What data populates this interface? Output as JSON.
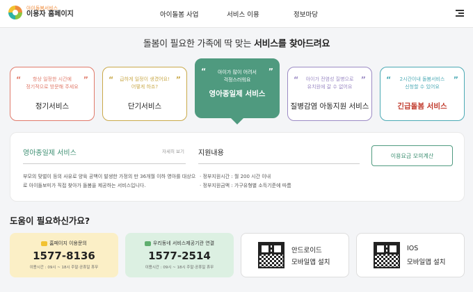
{
  "header": {
    "logo_sub": "아이돌봄서비스",
    "logo_main": "이용자 홈페이지",
    "nav": [
      "아이돌봄 사업",
      "서비스 이용",
      "정보마당"
    ],
    "menu_icon": "hamburger-menu-icon"
  },
  "headline": {
    "prefix": "돌봄이 필요한 가족에 딱 맞는 ",
    "emphasis": "서비스를 찾아드려요"
  },
  "service_cards": [
    {
      "quote_1": "항상 일정한 시간에",
      "quote_2": "정기적으로 방문해 주세요",
      "name": "정기서비스",
      "color": "#e07a6a",
      "active": false
    },
    {
      "quote_1": "급하게 일정이 생겼어요!",
      "quote_2": "어떻게 하죠?",
      "name": "단기서비스",
      "color": "#c9a94a",
      "active": false
    },
    {
      "quote_1": "아이가 많이 어려서",
      "quote_2": "걱정스러워요",
      "name": "영아종일제 서비스",
      "color": "#4f9a7f",
      "active": true
    },
    {
      "quote_1": "아이가 전염성 질병으로",
      "quote_2": "유치원에 갈 수 없어요",
      "name": "질병감염 아동지원 서비스",
      "color": "#9b8ac4",
      "active": false
    },
    {
      "quote_1": "2시간이내 돌봄서비스",
      "quote_2": "신청할 수 있어요",
      "name": "긴급돌봄 서비스",
      "color": "#4aa9b4",
      "active": false,
      "name_color": "#c0392b"
    }
  ],
  "detail": {
    "title": "영아종일제 서비스",
    "more": "자세히 보기",
    "desc": "부모의 맞벌이 등의 사유로 양육 공백이 발생한 가정의 만 36개월 이하 영아를 대상으로 아이돌보미가 직접 찾아가 돌봄을 제공하는 서비스입니다.",
    "support_title": "지원내용",
    "support_items": [
      "· 정부지원시간 : 월 200 시간 이내",
      "· 정부지원금액 : 가구유형별 소득기준에 따름"
    ],
    "calc_button": "이용요금 모의계산"
  },
  "help": {
    "title": "도움이 필요하신가요?",
    "phones": [
      {
        "label": "홈페이지 이용문의",
        "number": "1577-8136",
        "note": "이용시간 : 09시 ~ 18시 주말·공휴일 휴무",
        "bg": "#fbefc6",
        "icon_color": "#f2c230"
      },
      {
        "label": "우리동네 서비스제공기관 연결",
        "number": "1577-2514",
        "note": "이용시간 : 09시 ~ 18시 주말·공휴일 휴무",
        "bg": "#dcf0e2",
        "icon_color": "#5fae6e"
      }
    ],
    "apps": [
      {
        "name": "안드로이드",
        "sub": "모바일앱 설치"
      },
      {
        "name": "IOS",
        "sub": "모바일앱 설치"
      }
    ]
  }
}
